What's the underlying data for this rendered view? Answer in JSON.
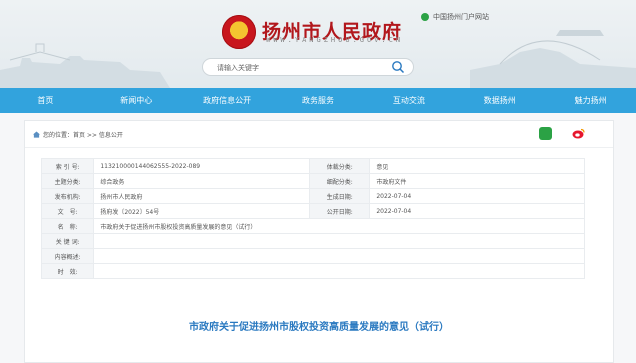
{
  "header": {
    "site_title": "扬州市人民政府",
    "site_url": "WWW.YANGZHOU.GOV.CN",
    "portal_link": "中国扬州门户网站",
    "search_placeholder": "请输入关键字"
  },
  "nav": [
    "首页",
    "新闻中心",
    "政府信息公开",
    "政务服务",
    "互动交流",
    "数据扬州",
    "魅力扬州"
  ],
  "breadcrumb": "您的位置：首页 >> 信息公开",
  "meta": {
    "index_label": "索 引 号:",
    "index_value": "113210000144062555-2022-089",
    "genre_label": "体裁分类:",
    "genre_value": "意见",
    "topic_label": "主题分类:",
    "topic_value": "综合政务",
    "detail_label": "细配分类:",
    "detail_value": "市政府文件",
    "org_label": "发布机构:",
    "org_value": "扬州市人民政府",
    "created_label": "生成日期:",
    "created_value": "2022-07-04",
    "docno_label": "文　号:",
    "docno_value": "扬府发〔2022〕54号",
    "public_label": "公开日期:",
    "public_value": "2022-07-04",
    "name_label": "名　称:",
    "name_value": "市政府关于促进扬州市股权投资高质量发展的意见（试行）",
    "keyword_label": "关 键 词:",
    "keyword_value": "",
    "summary_label": "内容概述:",
    "summary_value": "",
    "validity_label": "时　效:",
    "validity_value": ""
  },
  "doc_title": "市政府关于促进扬州市股权投资高质量发展的意见（试行）",
  "colors": {
    "nav": "#32a3dd",
    "brand_red": "#b2171c",
    "title_blue": "#2a79c0"
  }
}
